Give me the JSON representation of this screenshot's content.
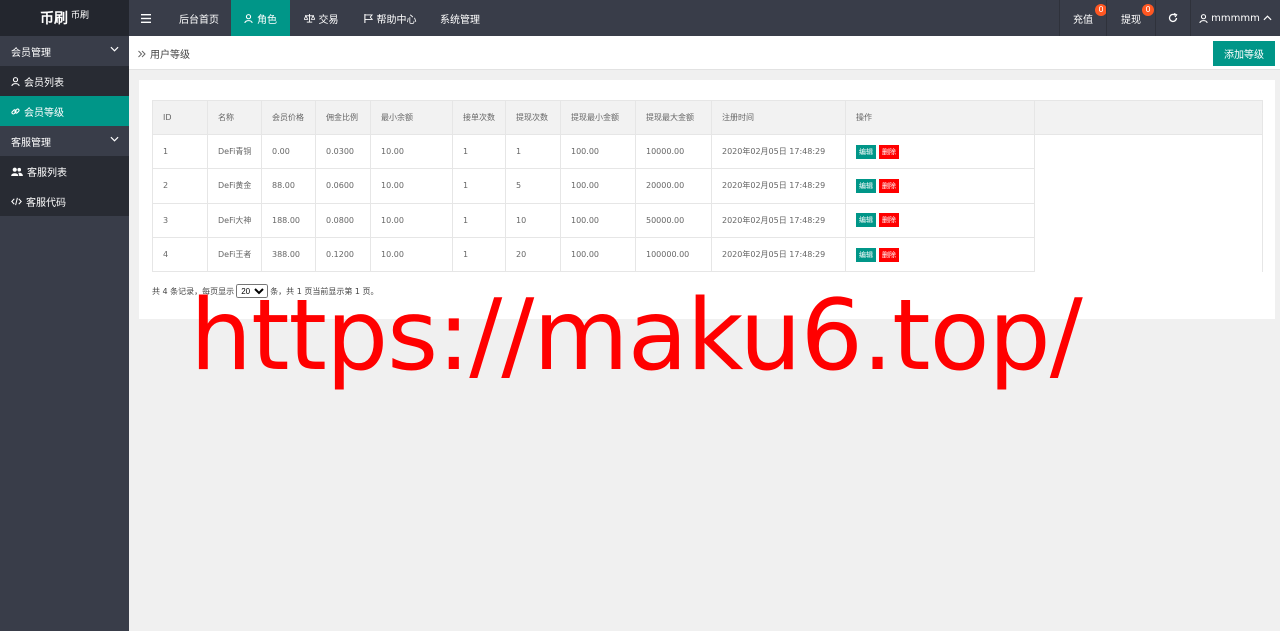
{
  "logo": {
    "main": "币刷",
    "small": "币刷"
  },
  "topnav": {
    "menu_icon": "hamburger-icon",
    "items": [
      {
        "label": "后台首页",
        "icon": ""
      },
      {
        "label": "角色",
        "icon": "user-icon"
      },
      {
        "label": "交易",
        "icon": "scale-icon"
      },
      {
        "label": "帮助中心",
        "icon": "flag-icon"
      },
      {
        "label": "系统管理",
        "icon": ""
      }
    ],
    "recharge": {
      "label": "充值",
      "badge": "0"
    },
    "withdraw": {
      "label": "提现",
      "badge": "0"
    },
    "refresh_icon": "refresh-icon",
    "user": {
      "name": "mmmmm",
      "icon": "user-icon"
    },
    "accent": "#009688"
  },
  "sidebar": {
    "groups": [
      {
        "label": "会员管理",
        "items": [
          {
            "label": "会员列表",
            "icon": "user-icon"
          },
          {
            "label": "会员等级",
            "icon": "link-icon"
          }
        ]
      },
      {
        "label": "客服管理",
        "items": [
          {
            "label": "客服列表",
            "icon": "users-icon"
          },
          {
            "label": "客服代码",
            "icon": "code-icon"
          }
        ]
      }
    ]
  },
  "breadcrumb": {
    "title": "用户等级"
  },
  "toolbar": {
    "add_label": "添加等级"
  },
  "table": {
    "headers": [
      "ID",
      "名称",
      "会员价格",
      "佣金比例",
      "最小余额",
      "接单次数",
      "提现次数",
      "提现最小金额",
      "提现最大金额",
      "注册时间",
      "操作"
    ],
    "rows": [
      [
        "1",
        "DeFi青铜",
        "0.00",
        "0.0300",
        "10.00",
        "1",
        "1",
        "100.00",
        "10000.00",
        "2020年02月05日 17:48:29"
      ],
      [
        "2",
        "DeFi黄金",
        "88.00",
        "0.0600",
        "10.00",
        "1",
        "5",
        "100.00",
        "20000.00",
        "2020年02月05日 17:48:29"
      ],
      [
        "3",
        "DeFi大神",
        "188.00",
        "0.0800",
        "10.00",
        "1",
        "10",
        "100.00",
        "50000.00",
        "2020年02月05日 17:48:29"
      ],
      [
        "4",
        "DeFi王者",
        "388.00",
        "0.1200",
        "10.00",
        "1",
        "20",
        "100.00",
        "100000.00",
        "2020年02月05日 17:48:29"
      ]
    ],
    "edit_label": "编辑",
    "delete_label": "删除"
  },
  "pager": {
    "prefix": "共 4 条记录，每页显示",
    "page_size": "20",
    "suffix": "条，共 1 页当前显示第 1 页。"
  },
  "watermark": "https://maku6.top/"
}
